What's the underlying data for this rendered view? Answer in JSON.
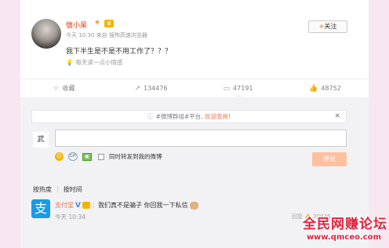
{
  "post": {
    "author": "信小呆",
    "star_glyph": "★",
    "medal_glyph": "♛",
    "meta": "今天 10:30 来自 搜狗高速浏览器",
    "follow_plus": "+",
    "follow_label": "关注",
    "text": "我下半生是不是不用工作了？？？",
    "source_icon": "💡",
    "source": "每天读一点小情感"
  },
  "actions": [
    {
      "icon": "☆",
      "label": "收藏"
    },
    {
      "icon": "↗",
      "label": "134476"
    },
    {
      "icon": "▭",
      "label": "47191"
    },
    {
      "icon": "👍",
      "label": "48752"
    }
  ],
  "notice": {
    "icon": "ⓘ",
    "text": "#微博群组#平台, ",
    "link": "欢迎查阅!",
    "close": "×"
  },
  "composer": {
    "avatar_text": "武",
    "emoji_glyph": "☺",
    "gif_glyph": "GIF",
    "image_glyph": "▣",
    "checkbox_label": "同时转发到我的微博",
    "submit_label": "评论"
  },
  "sort": {
    "hot": "按热度",
    "sep": "|",
    "time": "按时间"
  },
  "comment": {
    "avatar_glyph": "支",
    "author": "支付宝",
    "verified": "V",
    "colon": "：",
    "text": "我们真不是骗子 你回我一下私信",
    "time": "今天 10:34",
    "actions_text": "回复  👍 20936"
  },
  "watermark": {
    "title": "全民网赚论坛",
    "url": "www.qmceo.com"
  },
  "colors": {
    "accent": "#eb7350",
    "link_blue": "#3a8be0",
    "panel_grey": "#f2f2f5",
    "watermark_red": "#e0223c"
  }
}
